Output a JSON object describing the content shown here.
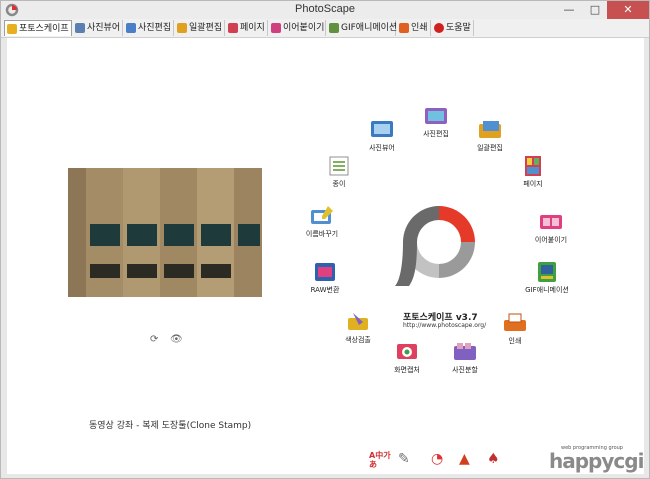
{
  "window": {
    "title": "PhotoScape",
    "minimize": "—",
    "maximize": "□",
    "close": "✕"
  },
  "tabs": [
    {
      "label": "포토스케이프",
      "icon": "photoscape-home-icon",
      "color": "#e8b020"
    },
    {
      "label": "사진뷰어",
      "icon": "viewer-icon",
      "color": "#5a7fb0"
    },
    {
      "label": "사진편집",
      "icon": "editor-icon",
      "color": "#4a7fc8"
    },
    {
      "label": "일괄편집",
      "icon": "batch-icon",
      "color": "#e0a020"
    },
    {
      "label": "페이지",
      "icon": "page-icon",
      "color": "#d04050"
    },
    {
      "label": "이어붙이기",
      "icon": "combine-icon",
      "color": "#d04080"
    },
    {
      "label": "GIF애니메이션",
      "icon": "gif-icon",
      "color": "#609040"
    },
    {
      "label": "인쇄",
      "icon": "print-icon",
      "color": "#e06020"
    },
    {
      "label": "도움말",
      "icon": "help-icon",
      "color": "#d02020"
    }
  ],
  "home": {
    "product_name": "포토스케이프 v3.7",
    "url": "http://www.photoscape.org/",
    "caption": "동영상 강좌 - 복제 도장툴(Clone Stamp)",
    "menu": [
      {
        "label": "사진뷰어",
        "icon": "viewer-icon",
        "color": "#3a7ac0"
      },
      {
        "label": "사진편집",
        "icon": "editor-icon",
        "color": "#9060c0"
      },
      {
        "label": "일괄편집",
        "icon": "batch-icon",
        "color": "#e0a020"
      },
      {
        "label": "페이지",
        "icon": "page-icon",
        "color": "#d04050"
      },
      {
        "label": "이어붙이기",
        "icon": "combine-icon",
        "color": "#e04080"
      },
      {
        "label": "GIF애니메이션",
        "icon": "gif-icon",
        "color": "#40a040"
      },
      {
        "label": "인쇄",
        "icon": "print-icon",
        "color": "#e07020"
      },
      {
        "label": "사진분할",
        "icon": "splitter-icon",
        "color": "#8060c0"
      },
      {
        "label": "화면캡처",
        "icon": "screen-capture-icon",
        "color": "#e04060"
      },
      {
        "label": "색상검출",
        "icon": "color-picker-icon",
        "color": "#e0b020"
      },
      {
        "label": "RAW변환",
        "icon": "raw-converter-icon",
        "color": "#3060b0"
      },
      {
        "label": "이름바꾸기",
        "icon": "rename-icon",
        "color": "#5090d0"
      },
      {
        "label": "종이",
        "icon": "paper-print-icon",
        "color": "#80b060"
      }
    ],
    "bottom_tools": [
      {
        "label": "A中가あ",
        "icon": "language-icon",
        "color": "#d03030"
      },
      {
        "label": "✎",
        "icon": "tools-icon",
        "color": "#707070"
      },
      {
        "label": "◔",
        "icon": "photoscape-logo-icon",
        "color": "#e03030"
      },
      {
        "label": "▲",
        "icon": "effects-icon",
        "color": "#d04020"
      },
      {
        "label": "♠",
        "icon": "fireworks-icon",
        "color": "#c03030"
      }
    ]
  },
  "brand": {
    "small": "web programming group",
    "big": "happycgi"
  }
}
